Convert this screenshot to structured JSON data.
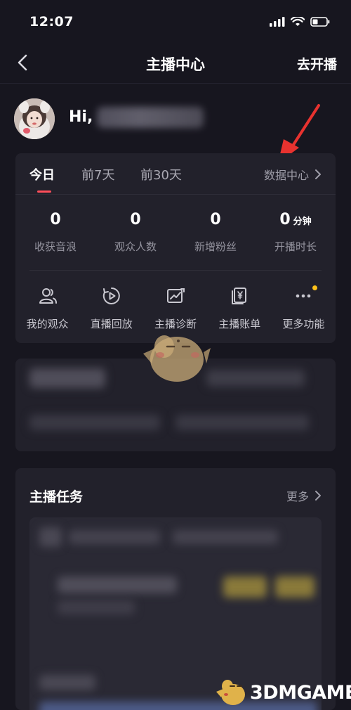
{
  "status_bar": {
    "time": "12:07"
  },
  "nav": {
    "title": "主播中心",
    "go_live": "去开播"
  },
  "profile": {
    "greeting": "Hi,"
  },
  "stats_card": {
    "tabs": [
      {
        "label": "今日",
        "active": true
      },
      {
        "label": "前7天",
        "active": false
      },
      {
        "label": "前30天",
        "active": false
      }
    ],
    "data_center": "数据中心",
    "stats": [
      {
        "value": "0",
        "unit": "",
        "label": "收获音浪"
      },
      {
        "value": "0",
        "unit": "",
        "label": "观众人数"
      },
      {
        "value": "0",
        "unit": "",
        "label": "新增粉丝"
      },
      {
        "value": "0",
        "unit": "分钟",
        "label": "开播时长"
      }
    ],
    "actions": [
      {
        "label": "我的观众",
        "icon": "audience-icon"
      },
      {
        "label": "直播回放",
        "icon": "replay-icon"
      },
      {
        "label": "主播诊断",
        "icon": "diagnosis-icon"
      },
      {
        "label": "主播账单",
        "icon": "bill-icon"
      },
      {
        "label": "更多功能",
        "icon": "more-icon",
        "badge": true
      }
    ]
  },
  "task_card": {
    "title": "主播任务",
    "more": "更多"
  },
  "watermark": {
    "text": "3DMGAME"
  },
  "colors": {
    "background": "#17161f",
    "card": "#22212b",
    "accent": "#ff4e5a",
    "arrow": "#e8322f",
    "badge": "#ffc21a"
  }
}
